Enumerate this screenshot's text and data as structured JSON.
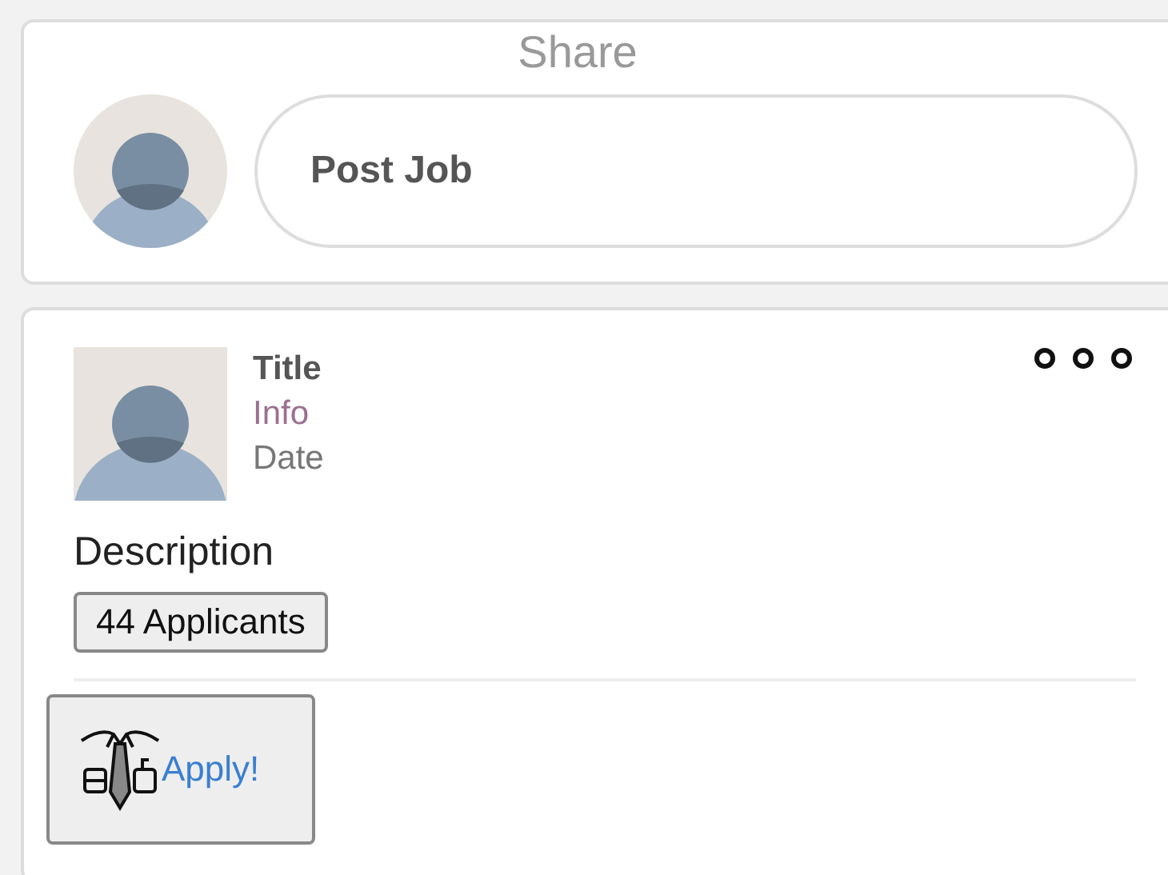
{
  "share": {
    "title": "Share",
    "post_button": "Post Job"
  },
  "job": {
    "title": "Title",
    "info": "Info",
    "date": "Date",
    "description": "Description",
    "applicants": "44 Applicants",
    "apply": "Apply!"
  }
}
